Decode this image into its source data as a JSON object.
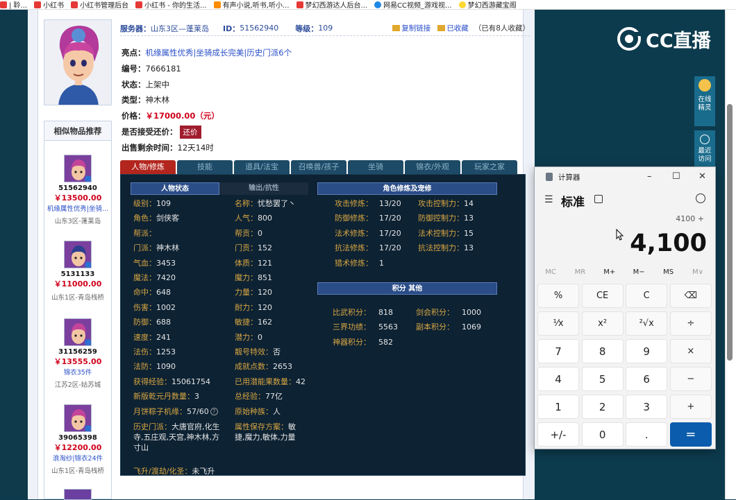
{
  "bookmarks": [
    {
      "label": "| 聆...",
      "icon": "site-icon"
    },
    {
      "label": "小红书",
      "icon": "xhs-icon"
    },
    {
      "label": "小红书管理后台",
      "icon": "xhs-icon"
    },
    {
      "label": "小红书 - 你的生活...",
      "icon": "xhs-icon"
    },
    {
      "label": "有声小说,听书,听小...",
      "icon": "book-icon"
    },
    {
      "label": "梦幻西游达人后台...",
      "icon": "game-icon"
    },
    {
      "label": "网易CC视频_游戏视...",
      "icon": "cc-icon"
    },
    {
      "label": "梦幻西游藏宝阁",
      "icon": "treasure-icon"
    }
  ],
  "listing": {
    "server_label": "服务器：",
    "server": "山东3区—蓬莱岛",
    "id_label": "ID：",
    "id": "51562940",
    "level_label": "等级：",
    "level": "109",
    "copy_link": "复制链接",
    "favorited": "已收藏",
    "fav_count": "（已有8人收藏）",
    "highlights_label": "亮点：",
    "highlights": "机缘属性优秀|坐骑成长完美|历史门派6个",
    "serial_label": "编号：",
    "serial": "7666181",
    "status_label": "状态：",
    "status": "上架中",
    "type_label": "类型：",
    "type": "神木林",
    "price_label": "价格：",
    "price": "￥17000.00（元）",
    "bargain_label": "是否接受还价：",
    "bargain_btn": "还价",
    "remaining_label": "出售剩余时间：",
    "remaining": "12天14时"
  },
  "similar": {
    "title": "相似物品推荐",
    "items": [
      {
        "id": "51562940",
        "price": "￥13500.00",
        "desc": "机缘属性优秀|坐骑...",
        "server": "山东3区-蓬莱岛"
      },
      {
        "id": "5131133",
        "price": "￥11000.00",
        "desc": "",
        "server": "山东1区-青岛栈桥"
      },
      {
        "id": "31156259",
        "price": "￥13555.00",
        "desc": "锦衣35件",
        "server": "江苏2区-姑苏城"
      },
      {
        "id": "39065398",
        "price": "￥12200.00",
        "desc": "浪淘纱|锦衣24件",
        "server": "山东1区-青岛栈桥"
      }
    ]
  },
  "tabs": [
    "人物/修炼",
    "技能",
    "道具/法宝",
    "召唤兽/孩子",
    "坐骑",
    "锦衣/外观",
    "玩家之家"
  ],
  "panel": {
    "sub_tabs": [
      "人物状态",
      "输出/抗性"
    ],
    "left_rows": [
      {
        "k": "级别：",
        "v": "109"
      },
      {
        "k": "角色：",
        "v": "剑侠客"
      },
      {
        "k": "帮派：",
        "v": ""
      },
      {
        "k": "门派：",
        "v": "神木林"
      },
      {
        "k": "气血：",
        "v": "3453"
      },
      {
        "k": "魔法：",
        "v": "7420"
      },
      {
        "k": "命中：",
        "v": "648"
      },
      {
        "k": "伤害：",
        "v": "1002"
      },
      {
        "k": "防御：",
        "v": "688"
      },
      {
        "k": "速度：",
        "v": "241"
      },
      {
        "k": "法伤：",
        "v": "1253"
      },
      {
        "k": "法防：",
        "v": "1090"
      },
      {
        "k": "获得经验：",
        "v": "15061754"
      },
      {
        "k": "新版乾元丹数量：",
        "v": "3"
      },
      {
        "k": "月饼粽子机缘：",
        "v": "57/60"
      }
    ],
    "mid_rows": [
      {
        "k": "名称：",
        "v": "忧愁罢了丶"
      },
      {
        "k": "人气：",
        "v": "800"
      },
      {
        "k": "帮贡：",
        "v": "0"
      },
      {
        "k": "门贡：",
        "v": "152"
      },
      {
        "k": "体质：",
        "v": "121"
      },
      {
        "k": "魔力：",
        "v": "851"
      },
      {
        "k": "力量：",
        "v": "120"
      },
      {
        "k": "耐力：",
        "v": "120"
      },
      {
        "k": "敏捷：",
        "v": "162"
      },
      {
        "k": "潜力：",
        "v": "0"
      },
      {
        "k": "靓号特效：",
        "v": "否"
      },
      {
        "k": "成就点数：",
        "v": "2653"
      },
      {
        "k": "已用潜能果数量：",
        "v": "42"
      },
      {
        "k": "总经验：",
        "v": "77亿"
      },
      {
        "k": "原始种族：",
        "v": "人"
      }
    ],
    "history_k": "历史门派：",
    "history_v1": "大唐官府,化生",
    "history_v2": "寺,五庄观,天宫,神木林,方",
    "history_v3": "寸山",
    "attr_k": "属性保存方案：",
    "attr_v1": "敏",
    "attr_v2": "捷,魔力,敏体,力量",
    "fly_k": "飞升/渡劫/化圣：",
    "fly_v": "未飞升",
    "cult_title": "角色修炼及宠修",
    "cult_rows": [
      {
        "k1": "攻击修炼：",
        "v1": "13/20",
        "k2": "攻击控制力：",
        "v2": "14"
      },
      {
        "k1": "防御修炼：",
        "v1": "17/20",
        "k2": "防御控制力：",
        "v2": "13"
      },
      {
        "k1": "法术修炼：",
        "v1": "17/20",
        "k2": "法术控制力：",
        "v2": "15"
      },
      {
        "k1": "抗法修炼：",
        "v1": "17/20",
        "k2": "抗法控制力：",
        "v2": "13"
      },
      {
        "k1": "猎术修炼：",
        "v1": "1",
        "k2": "",
        "v2": ""
      }
    ],
    "points_title": "积分 其他",
    "points_rows": [
      {
        "k1": "比武积分：",
        "v1": "818",
        "k2": "剑会积分：",
        "v2": "1000"
      },
      {
        "k1": "三界功绩：",
        "v1": "5563",
        "k2": "副本积分：",
        "v2": "1069"
      },
      {
        "k1": "神器积分：",
        "v1": "582",
        "k2": "",
        "v2": ""
      }
    ]
  },
  "sidebar": {
    "online_label": "在线\n精灵",
    "recent_label": "最近\n访问"
  },
  "brand": "CC直播",
  "calculator": {
    "title": "计算器",
    "mode": "标准",
    "expression": "4100 +",
    "display": "4,100",
    "memory": [
      "MC",
      "MR",
      "M+",
      "M−",
      "MS",
      "M∨"
    ],
    "keys": [
      "%",
      "CE",
      "C",
      "⌫",
      "¹⁄x",
      "x²",
      "²√x",
      "÷",
      "7",
      "8",
      "9",
      "×",
      "4",
      "5",
      "6",
      "−",
      "1",
      "2",
      "3",
      "+",
      "+/-",
      "0",
      ".",
      "="
    ]
  },
  "colors": {
    "accent": "#b3261e",
    "brand": "#0b5cad",
    "price": "#d0021b"
  }
}
